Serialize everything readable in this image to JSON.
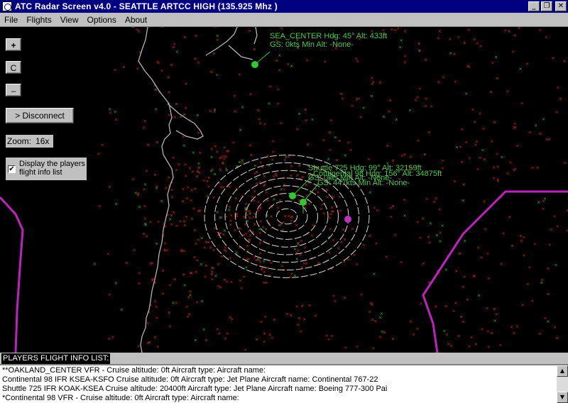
{
  "window": {
    "title": "ATC Radar Screen v4.0 - SEATTLE ARTCC HIGH (135.925 Mhz  )",
    "min_glyph": "_",
    "max_glyph": "❐",
    "close_glyph": "✕"
  },
  "menu": [
    "File",
    "Flights",
    "View",
    "Options",
    "About"
  ],
  "controls": {
    "zoom_in": "+",
    "center": "C",
    "zoom_out": "–",
    "disconnect": "> Disconnect",
    "zoom_label": "Zoom:",
    "zoom_value": "16x",
    "display_info_label": "Display the players flight info list",
    "display_info_checked": true,
    "check_glyph": "✔"
  },
  "aircraft": [
    {
      "callsign": "SEA_CENTER",
      "heading": "45°",
      "altitude": "433ft",
      "gs": "0kts",
      "min_alt": "-None-",
      "line1": "SEA_CENTER  Hdg: 45°  Alt: 433ft",
      "line2": "GS: 0kts  Min Alt: -None-"
    },
    {
      "callsign": "Shuttle 725",
      "line1": "Shuttle 725  Hdg: 99°  Alt: 32159ft"
    },
    {
      "callsign": "Continental 98",
      "line1": "Continental 98  Hdg: 156°  Alt: 34875ft"
    },
    {
      "line1": "GS: 0kts  Min Alt: -None-"
    },
    {
      "line1": "GS: 447kts  Min Alt: -None-"
    }
  ],
  "colors": {
    "radar_bg": "#000000",
    "coast": "#b4b4b4",
    "boundary": "#c020c0",
    "aircraft": "#30c830",
    "target_other": "#c030c0",
    "ground_red": "#e02020",
    "ground_green": "#20c020"
  },
  "info_list": {
    "caption": "PLAYERS FLIGHT INFO LIST:",
    "lines": [
      "**OAKLAND_CENTER   VFR   -   Cruise altitude: 0ft   Aircraft type:    Aircraft name:",
      "Continental 98   IFR   KSEA-KSFO   Cruise altitude: 0ft   Aircraft type: Jet Plane   Aircraft name: Continental 767-22",
      "Shuttle 725   IFR   KOAK-KSEA   Cruise altitude: 20400ft   Aircraft type: Jet Plane   Aircraft name: Boeing 777-300 Pai",
      "*Continental 98   VFR   -   Cruise altitude: 0ft   Aircraft type:    Aircraft name:"
    ],
    "scroll_up": "▲",
    "scroll_down": "▼"
  }
}
